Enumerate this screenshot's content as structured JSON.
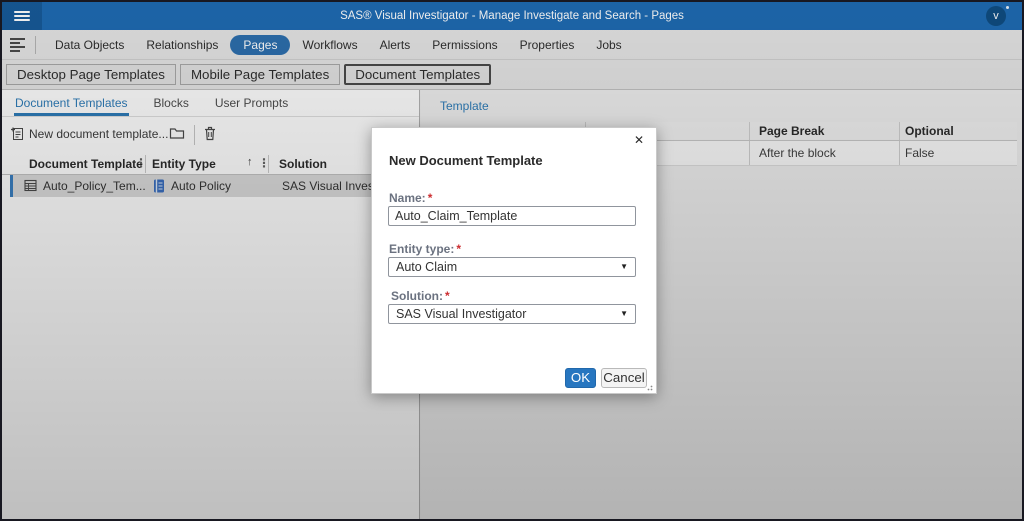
{
  "colors": {
    "topbar_blue": "#1e6bb3",
    "accent_blue": "#2e7cb8",
    "pill_blue": "#2d6fae",
    "ok_button_blue": "#2776c0",
    "required_red": "#cc2d30",
    "row_selection_blue": "#3a7fc1"
  },
  "topbar": {
    "title": "SAS® Visual Investigator - Manage Investigate and Search - Pages",
    "user_initial": "v"
  },
  "nav": {
    "items": [
      "Data Objects",
      "Relationships",
      "Pages",
      "Workflows",
      "Alerts",
      "Permissions",
      "Properties",
      "Jobs"
    ],
    "active": "Pages"
  },
  "view_switcher": {
    "buttons": [
      "Desktop Page Templates",
      "Mobile Page Templates",
      "Document Templates"
    ],
    "active": "Document Templates"
  },
  "left_panel": {
    "tabs": [
      "Document Templates",
      "Blocks",
      "User Prompts"
    ],
    "active_tab": "Document Templates",
    "toolbar": {
      "new_template_label": "New document template..."
    },
    "table": {
      "columns": [
        "Document Template",
        "Entity Type",
        "Solution"
      ],
      "sorted_by": "Entity Type",
      "sort_direction": "ascending",
      "rows": [
        {
          "document_template": "Auto_Policy_Tem...",
          "entity_type": "Auto Policy",
          "solution": "SAS Visual Investigator"
        }
      ]
    }
  },
  "right_panel": {
    "tab_label": "Template",
    "table": {
      "columns": [
        "Page Break",
        "Optional"
      ],
      "rows": [
        {
          "page_break": "After the block",
          "optional": "False"
        }
      ]
    }
  },
  "dialog": {
    "title": "New Document Template",
    "close_label": "✕",
    "name_label": "Name:",
    "entity_label": "Entity type:",
    "solution_label": "Solution:",
    "required_marker": "*",
    "name_value": "Auto_Claim_Template",
    "entity_value": "Auto Claim",
    "solution_value": "SAS Visual Investigator",
    "ok_label": "OK",
    "cancel_label": "Cancel"
  }
}
